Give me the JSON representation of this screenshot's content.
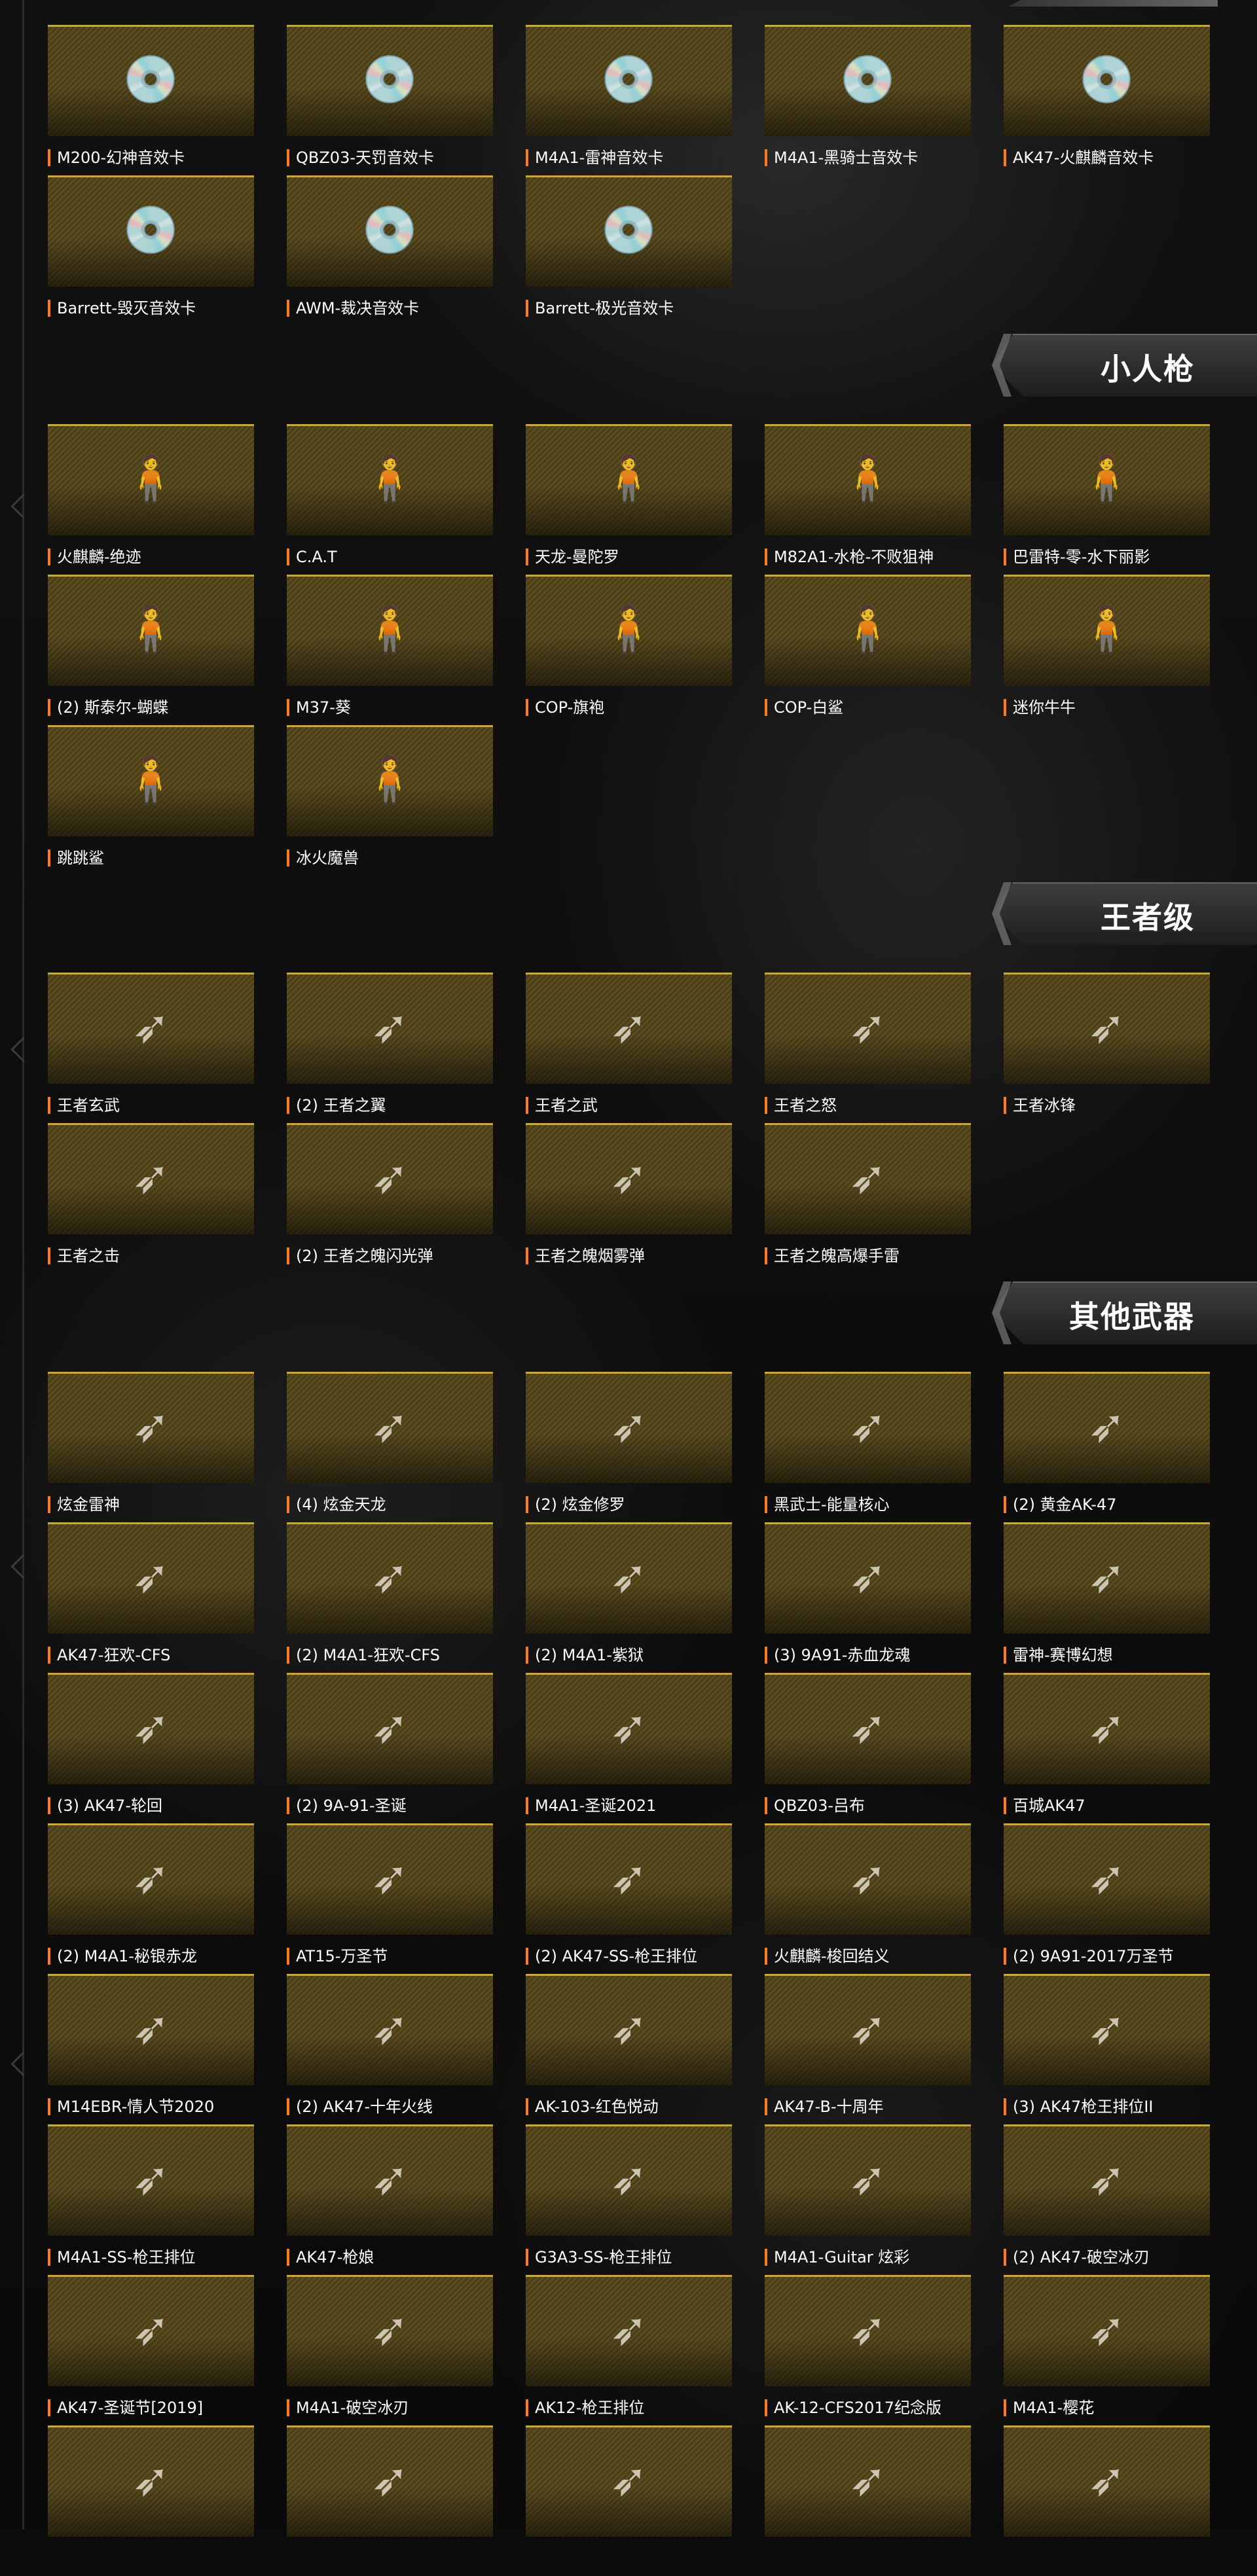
{
  "sections": {
    "sound_cards": {
      "title": "",
      "items": [
        "M200-幻神音效卡",
        "QBZ03-天罚音效卡",
        "M4A1-雷神音效卡",
        "M4A1-黑骑士音效卡",
        "AK47-火麒麟音效卡",
        "Barrett-毁灭音效卡",
        "AWM-裁决音效卡",
        "Barrett-极光音效卡"
      ]
    },
    "mini_guns": {
      "title": "小人枪",
      "items": [
        "火麒麟-绝迹",
        "C.A.T",
        "天龙-曼陀罗",
        "M82A1-水枪-不败狙神",
        "巴雷特-零-水下丽影",
        "(2) 斯泰尔-蝴蝶",
        "M37-葵",
        "COP-旗袍",
        "COP-白鲨",
        "迷你牛牛",
        "跳跳鲨",
        "冰火魔兽"
      ]
    },
    "king_class": {
      "title": "王者级",
      "items": [
        "王者玄武",
        "(2) 王者之翼",
        "王者之武",
        "王者之怒",
        "王者冰锋",
        "王者之击",
        "(2) 王者之魄闪光弹",
        "王者之魄烟雾弹",
        "王者之魄高爆手雷"
      ]
    },
    "other_weapons": {
      "title": "其他武器",
      "items": [
        "炫金雷神",
        "(4) 炫金天龙",
        "(2) 炫金修罗",
        "黑武士-能量核心",
        "(2) 黄金AK-47",
        "AK47-狂欢-CFS",
        "(2) M4A1-狂欢-CFS",
        "(2) M4A1-紫狱",
        "(3) 9A91-赤血龙魂",
        "雷神-赛博幻想",
        "(3) AK47-轮回",
        "(2) 9A-91-圣诞",
        "M4A1-圣诞2021",
        "QBZ03-吕布",
        "百城AK47",
        "(2) M4A1-秘银赤龙",
        "AT15-万圣节",
        "(2) AK47-SS-枪王排位",
        "火麒麟-梭回结义",
        "(2) 9A91-2017万圣节",
        "M14EBR-情人节2020",
        "(2) AK47-十年火线",
        "AK-103-红色悦动",
        "AK47-B-十周年",
        "(3) AK47枪王排位II",
        "M4A1-SS-枪王排位",
        "AK47-枪娘",
        "G3A3-SS-枪王排位",
        "M4A1-Guitar 炫彩",
        "(2) AK47-破空冰刃",
        "AK47-圣诞节[2019]",
        "M4A1-破空冰刃",
        "AK12-枪王排位",
        "AK-12-CFS2017纪念版",
        "M4A1-樱花",
        "",
        "",
        "",
        "",
        ""
      ]
    }
  },
  "icons": {
    "sound_card": "disc-icon",
    "mini_gun": "figure-icon",
    "weapon": "gun-icon"
  },
  "colors": {
    "accent": "#ff7a1a",
    "card_gold": "#5c4d20",
    "card_border": "#c9a640"
  }
}
